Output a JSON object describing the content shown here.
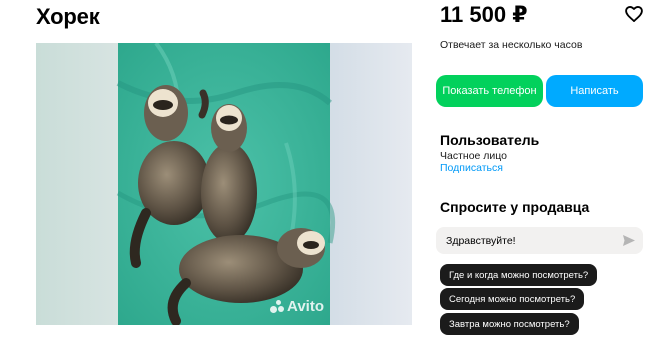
{
  "listing": {
    "title": "Хорек",
    "price": "11 500 ₽",
    "reply_time": "Отвечает за несколько часов",
    "photo_watermark": "Avito"
  },
  "actions": {
    "show_phone_label": "Показать телефон",
    "write_label": "Написать"
  },
  "seller": {
    "name": "Пользователь",
    "type": "Частное лицо",
    "subscribe_label": "Подписаться"
  },
  "ask": {
    "title": "Спросите у продавца",
    "message_value": "Здравствуйте!",
    "quick_questions": [
      "Где и когда можно посмотреть?",
      "Сегодня можно посмотреть?",
      "Завтра можно посмотреть?"
    ]
  },
  "colors": {
    "phone_button": "#02d15c",
    "write_button": "#00aaff",
    "link": "#0099f7",
    "chip": "#1b1b1b"
  },
  "icons": {
    "favorite": "heart-outline-icon",
    "send": "send-arrow-icon",
    "watermark": "avito-logo-icon"
  }
}
